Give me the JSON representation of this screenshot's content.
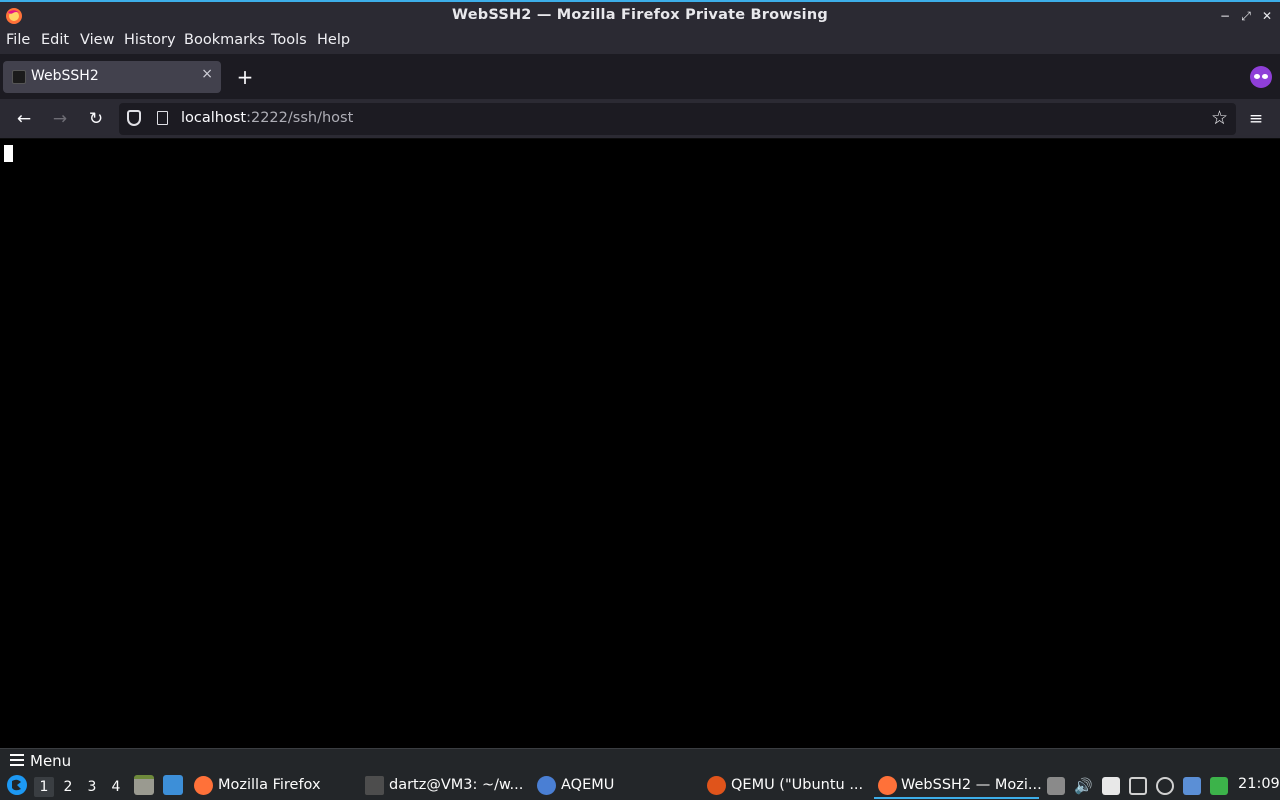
{
  "window": {
    "title": "WebSSH2 — Mozilla Firefox Private Browsing",
    "minimize_glyph": "−",
    "maximize_glyph": "⤢",
    "close_glyph": "✕"
  },
  "menu": {
    "items": [
      "File",
      "Edit",
      "View",
      "History",
      "Bookmarks",
      "Tools",
      "Help"
    ]
  },
  "tabs": {
    "items": [
      {
        "label": "WebSSH2",
        "close_glyph": "×"
      }
    ],
    "new_tab_glyph": "+"
  },
  "nav": {
    "back_glyph": "←",
    "forward_glyph": "→",
    "reload_glyph": "↻",
    "url_host": "localhost",
    "url_rest": ":2222/ssh/host",
    "bookmark_glyph": "☆",
    "menu_glyph": "≡"
  },
  "terminal": {
    "content": ""
  },
  "taskbar": {
    "menu_label": "Menu",
    "workspaces": [
      "1",
      "2",
      "3",
      "4"
    ],
    "active_workspace": "1",
    "tasks": [
      {
        "label": "Mozilla Firefox",
        "icon": "firefox-icon"
      },
      {
        "label": "dartz@VM3: ~/w...",
        "icon": "terminal-icon"
      },
      {
        "label": "AQEMU",
        "icon": "aqemu-icon"
      },
      {
        "label": "QEMU (\"Ubuntu ...",
        "icon": "qemu-icon"
      },
      {
        "label": "WebSSH2 — Mozi...",
        "icon": "firefox-icon"
      }
    ],
    "clock": "21:09"
  },
  "colors": {
    "accent": "#3daee9",
    "private_purple": "#8f3fd8",
    "firefox_orange": "#ff7139"
  }
}
